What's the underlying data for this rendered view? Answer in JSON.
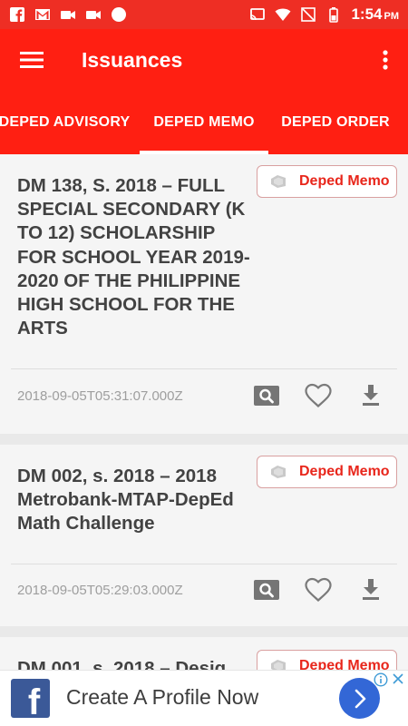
{
  "status_bar": {
    "time": "1:54",
    "ampm": "PM",
    "icons": [
      "facebook-icon",
      "gmail-icon",
      "video-icon",
      "video-icon",
      "circle-icon",
      "cast-icon",
      "wifi-icon",
      "no-signal-icon",
      "battery-icon"
    ]
  },
  "app_bar": {
    "title": "Issuances",
    "menu_icon": "hamburger-menu-icon",
    "more_icon": "more-vertical-icon"
  },
  "tabs": [
    {
      "label": "DEPED ADVISORY",
      "selected": false
    },
    {
      "label": "DEPED MEMO",
      "selected": true
    },
    {
      "label": "DEPED ORDER",
      "selected": false
    }
  ],
  "cards": [
    {
      "title": "DM 138, S. 2018 – FULL SPECIAL SECONDARY (K TO 12) SCHOLARSHIP FOR SCHOOL YEAR 2019-2020 OF THE PHILIPPINE HIGH SCHOOL FOR THE ARTS",
      "badge": "Deped Memo",
      "timestamp": "2018-09-05T05:31:07.000Z"
    },
    {
      "title": "DM 002, s. 2018 – 2018 Metrobank-MTAP-DepEd Math Challenge",
      "badge": "Deped Memo",
      "timestamp": "2018-09-05T05:29:03.000Z"
    },
    {
      "title": "DM 001, s. 2018 – Desig",
      "badge": "Deped Memo",
      "timestamp": ""
    }
  ],
  "ad": {
    "logo_letter": "f",
    "text": "Create A Profile Now"
  },
  "colors": {
    "primary": "#ff1f12",
    "status_bar": "#ee2e24",
    "badge_text": "#e8261b",
    "ad_button": "#3367d6",
    "facebook_blue": "#3b5998"
  }
}
